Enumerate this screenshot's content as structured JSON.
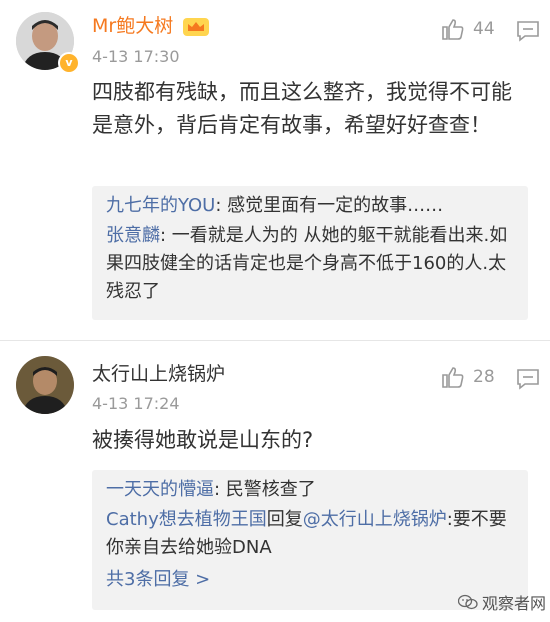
{
  "comments": [
    {
      "username": "Mr鲍大树",
      "time": "4-13 17:30",
      "likes": "44",
      "text": "四肢都有残缺，而且这么整齐，我觉得不可能是意外，背后肯定有故事，希望好好查查！",
      "replies": [
        {
          "name": "九七年的YOU",
          "sep": ": ",
          "text": "感觉里面有一定的故事……"
        },
        {
          "name": "张意麟",
          "sep": ": ",
          "text": "一看就是人为的 从她的躯干就能看出来.如果四肢健全的话肯定也是个身高不低于160的人.太残忍了"
        }
      ],
      "name_color": "#f5791f"
    },
    {
      "username": "太行山上烧锅炉",
      "time": "4-13 17:24",
      "likes": "28",
      "text": "被揍得她敢说是山东的?",
      "replies": [
        {
          "name": "一天天的懵逼",
          "sep": ": ",
          "text": "民警核查了"
        },
        {
          "name": "Cathy想去植物王国",
          "mid": "回复",
          "at": "@太行山上烧锅炉",
          "text": ":要不要你亲自去给她验DNA"
        }
      ],
      "more_replies": "共3条回复 >"
    }
  ],
  "watermark": "观察者网",
  "icons": [
    "verified-badge-icon",
    "crown-icon",
    "thumbs-up-icon",
    "comment-icon",
    "watermark-logo-icon"
  ],
  "colors": {
    "link": "#4e6ea6",
    "meta": "#9a9a9a",
    "subbox_bg": "#f2f2f2",
    "vip_orange": "#f5791f"
  }
}
